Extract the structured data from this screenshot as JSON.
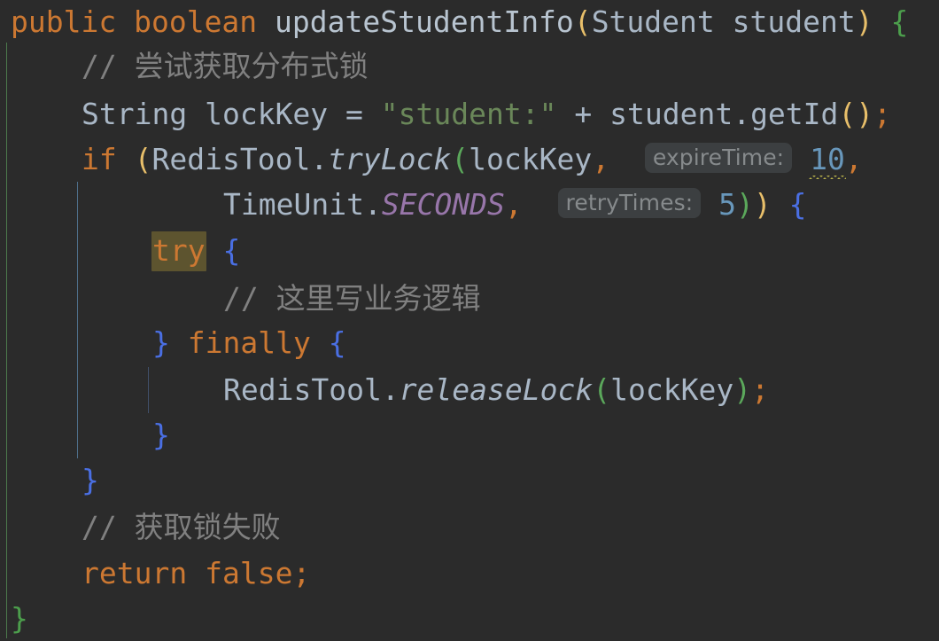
{
  "editor": {
    "language": "java",
    "background_color": "#2b2b2b",
    "theme": "darcula"
  },
  "colors": {
    "keyword": "#cc7832",
    "identifier": "#a9b7c6",
    "string": "#6a8759",
    "number": "#6897bb",
    "comment": "#808080",
    "static_field": "#9876aa",
    "bracket_level1": "#e8bf6a",
    "bracket_level2": "#5ba85b",
    "bracket_level3": "#4a6fe3",
    "brace_outer": "#4c9e4c",
    "highlight_bg": "#5d542f",
    "hint_bg": "#3c3f41",
    "hint_text": "#868a8c",
    "warning_squiggle": "#b9b34b"
  },
  "code": {
    "line1": {
      "kw_public": "public",
      "kw_boolean": "boolean",
      "method_name": "updateStudentInfo",
      "paren_open": "(",
      "type_student": "Student",
      "param_student": "student",
      "paren_close": ")",
      "brace_open": "{"
    },
    "line2": {
      "comment": "// 尝试获取分布式锁"
    },
    "line3": {
      "type_string": "String",
      "var_lockkey": "lockKey",
      "assign": "=",
      "string_literal": "\"student:\"",
      "plus": "+",
      "obj_student": "student",
      "dot": ".",
      "method_getid": "getId",
      "paren_open": "(",
      "paren_close": ")",
      "semicolon": ";"
    },
    "line4": {
      "kw_if": "if",
      "paren_open": "(",
      "class_redistool": "RedisTool",
      "dot": ".",
      "method_trylock": "tryLock",
      "paren_open2": "(",
      "arg_lockkey": "lockKey",
      "comma": ",",
      "hint_expiretime": "expireTime:",
      "num_10": "10",
      "comma2": ","
    },
    "line5": {
      "class_timeunit": "TimeUnit",
      "dot": ".",
      "field_seconds": "SECONDS",
      "comma": ",",
      "hint_retrytimes": "retryTimes:",
      "num_5": "5",
      "paren_close1": ")",
      "paren_close2": ")",
      "brace_open": "{"
    },
    "line6": {
      "kw_try": "try",
      "brace_open": "{"
    },
    "line7": {
      "comment": "// 这里写业务逻辑"
    },
    "line8": {
      "brace_close": "}",
      "kw_finally": "finally",
      "brace_open": "{"
    },
    "line9": {
      "class_redistool": "RedisTool",
      "dot": ".",
      "method_releaselock": "releaseLock",
      "paren_open": "(",
      "arg_lockkey": "lockKey",
      "paren_close": ")",
      "semicolon": ";"
    },
    "line10": {
      "brace_close": "}"
    },
    "line11": {
      "brace_close": "}"
    },
    "line12": {
      "comment": "// 获取锁失败"
    },
    "line13": {
      "kw_return": "return",
      "kw_false": "false",
      "semicolon": ";"
    },
    "line14": {
      "brace_close": "}"
    }
  }
}
